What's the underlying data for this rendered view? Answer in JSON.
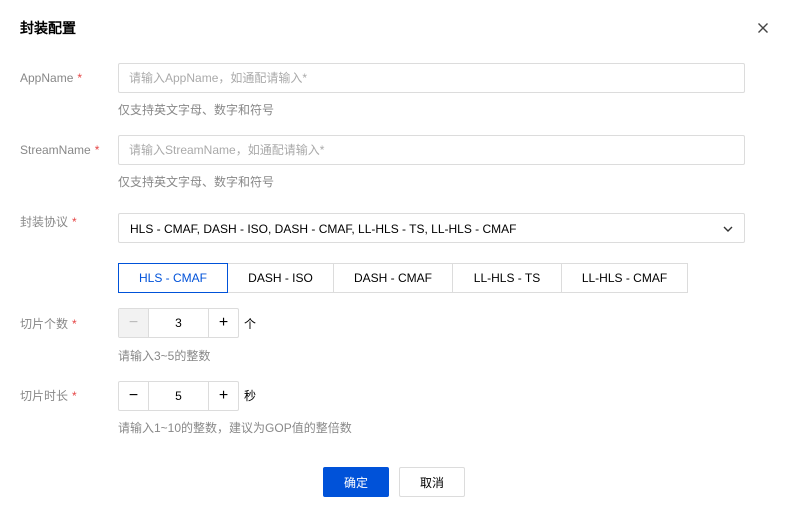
{
  "dialog": {
    "title": "封装配置",
    "close_icon": "close-icon"
  },
  "form": {
    "app_name": {
      "label": "AppName",
      "required_mark": "*",
      "placeholder": "请输入AppName，如通配请输入*",
      "value": "",
      "hint": "仅支持英文字母、数字和符号"
    },
    "stream_name": {
      "label": "StreamName",
      "required_mark": "*",
      "placeholder": "请输入StreamName，如通配请输入*",
      "value": "",
      "hint": "仅支持英文字母、数字和符号"
    },
    "protocol": {
      "label": "封装协议",
      "required_mark": "*",
      "selected_value": "HLS - CMAF, DASH - ISO, DASH - CMAF, LL-HLS - TS, LL-HLS - CMAF",
      "icon": "chevron-down-icon",
      "tabs": [
        {
          "label": "HLS - CMAF",
          "active": true
        },
        {
          "label": "DASH - ISO",
          "active": false
        },
        {
          "label": "DASH - CMAF",
          "active": false
        },
        {
          "label": "LL-HLS - TS",
          "active": false
        },
        {
          "label": "LL-HLS - CMAF",
          "active": false
        }
      ]
    },
    "segment_count": {
      "label": "切片个数",
      "required_mark": "*",
      "minus": "−",
      "plus": "+",
      "value": "3",
      "unit": "个",
      "hint": "请输入3~5的整数"
    },
    "segment_duration": {
      "label": "切片时长",
      "required_mark": "*",
      "minus": "−",
      "plus": "+",
      "value": "5",
      "unit": "秒",
      "hint": "请输入1~10的整数，建议为GOP值的整倍数"
    }
  },
  "footer": {
    "confirm": "确定",
    "cancel": "取消"
  },
  "colors": {
    "primary": "#0052d9",
    "required": "#e54545",
    "border": "#dcdcdc",
    "muted": "#888888"
  }
}
